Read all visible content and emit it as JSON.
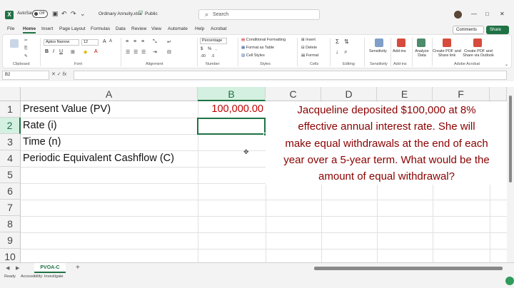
{
  "titlebar": {
    "autosave_label": "AutoSave",
    "autosave_state": "Off",
    "filename": "Ordinary Annuity.xlsx",
    "visibility": "Public",
    "search_placeholder": "Search"
  },
  "ribbon_tabs": [
    "File",
    "Home",
    "Insert",
    "Page Layout",
    "Formulas",
    "Data",
    "Review",
    "View",
    "Automate",
    "Help",
    "Acrobat"
  ],
  "active_tab": "Home",
  "buttons": {
    "comments": "Comments",
    "share": "Share"
  },
  "ribbon": {
    "font_name": "Aptos Narrow",
    "font_size": "12",
    "number_format": "Percentage",
    "styles": [
      "Conditional Formatting",
      "Format as Table",
      "Cell Styles"
    ],
    "cells": [
      "Insert",
      "Delete",
      "Format"
    ],
    "sensitivity": "Sensitivity",
    "addins": "Add-ins",
    "analyze": "Analyze Data",
    "create_pdf_link": "Create PDF and Share link",
    "create_pdf_outlook": "Create PDF and Share via Outlook",
    "groups": [
      "Clipboard",
      "Font",
      "Alignment",
      "Number",
      "Styles",
      "Cells",
      "Editing",
      "Sensitivity",
      "Add-ins",
      "Adobe Acrobat"
    ]
  },
  "formula_bar": {
    "name_box": "B2",
    "formula": ""
  },
  "columns": [
    "A",
    "B",
    "C",
    "D",
    "E",
    "F"
  ],
  "rows": [
    "1",
    "2",
    "3",
    "4",
    "5",
    "6",
    "7",
    "8",
    "9",
    "10"
  ],
  "cells": {
    "A1": "Present Value (PV)",
    "A2": "Rate (i)",
    "A3": "Time (n)",
    "A4": "Periodic Equivalent Cashflow (C)",
    "B1": "100,000.00"
  },
  "problem_lines": [
    "Jacqueline deposited $100,000 at 8%",
    "effective annual interest rate. She will",
    "make equal withdrawals at the end of each",
    "year over a 5-year term. What would be the",
    "amount of equal withdrawal?"
  ],
  "sheet_tab": "PVOA-C",
  "status": {
    "ready": "Ready",
    "accessibility": "Accessibility: Investigate"
  },
  "colors": {
    "accent": "#1f7244",
    "value_red": "#c00000",
    "note_red": "#8b0000"
  }
}
